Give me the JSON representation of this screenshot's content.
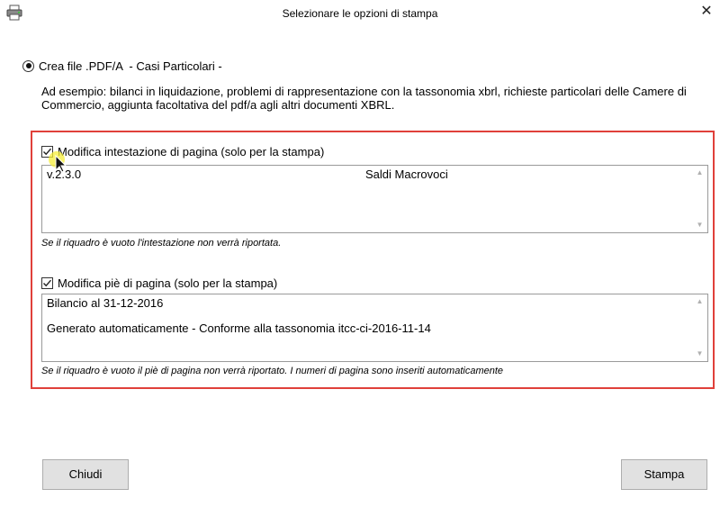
{
  "window": {
    "title": "Selezionare le opzioni di stampa",
    "close_glyph": "✕"
  },
  "option": {
    "radio_label": "Crea file .PDF/A  - Casi Particolari -",
    "selected": true,
    "description": "Ad esempio: bilanci in liquidazione, problemi di rappresentazione con la tassonomia xbrl, richieste particolari delle Camere di Commercio, aggiunta facoltativa del pdf/a agli altri documenti XBRL."
  },
  "header_section": {
    "checkbox_label": "Modifica intestazione di pagina (solo per la stampa)",
    "checked": true,
    "text_left": "v.2.3.0",
    "text_center": "Saldi Macrovoci",
    "hint": "Se il riquadro è vuoto l'intestazione non verrà riportata."
  },
  "footer_section": {
    "checkbox_label": "Modifica piè di pagina (solo per la stampa)",
    "checked": true,
    "line1": "Bilancio al 31-12-2016",
    "line2": "Generato automaticamente - Conforme alla tassonomia itcc-ci-2016-11-14",
    "hint": "Se il riquadro è vuoto il piè di pagina non verrà riportato. I numeri di pagina sono inseriti automaticamente"
  },
  "buttons": {
    "close_label": "Chiudi",
    "print_label": "Stampa"
  },
  "colors": {
    "highlight_border": "#e0403a",
    "button_bg": "#e1e1e1"
  }
}
